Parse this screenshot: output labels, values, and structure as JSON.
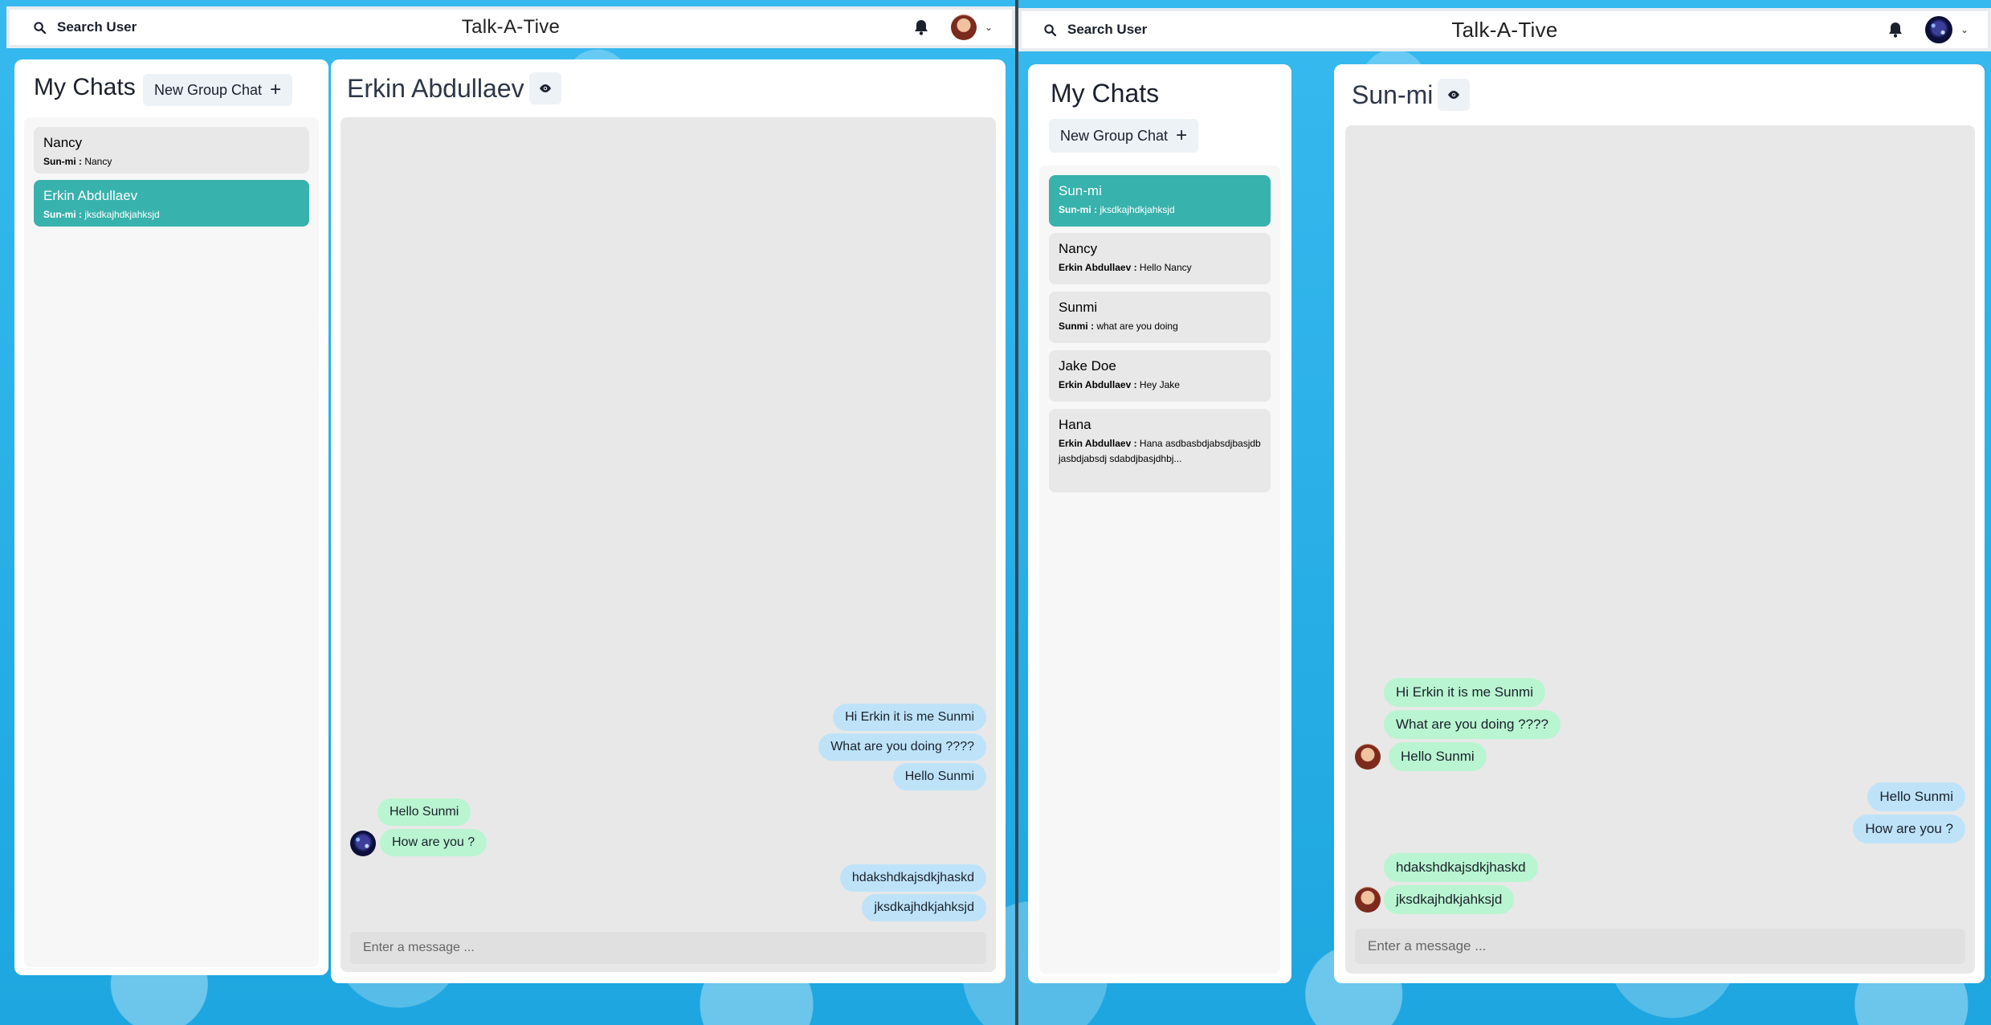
{
  "left": {
    "topbar": {
      "search_label": "Search User",
      "app_title": "Talk-A-Tive"
    },
    "sidebar": {
      "title": "My Chats",
      "new_group_label": "New Group Chat",
      "chats": [
        {
          "name": "Nancy",
          "sender": "Sun-mi :",
          "message": "Nancy",
          "active": false
        },
        {
          "name": "Erkin Abdullaev",
          "sender": "Sun-mi :",
          "message": "jksdkajhdkjahksjd",
          "active": true
        }
      ]
    },
    "chat": {
      "title": "Erkin Abdullaev",
      "messages": [
        {
          "text": "Hi Erkin it is me Sunmi",
          "type": "sent"
        },
        {
          "text": "What are you doing ????",
          "type": "sent"
        },
        {
          "text": "Hello Sunmi",
          "type": "sent"
        },
        {
          "text": "Hello Sunmi",
          "type": "received"
        },
        {
          "text": "How are you ?",
          "type": "received"
        },
        {
          "text": "hdakshdkajsdkjhaskd",
          "type": "sent"
        },
        {
          "text": "jksdkajhdkjahksjd",
          "type": "sent"
        }
      ],
      "input_placeholder": "Enter a message ..."
    }
  },
  "right": {
    "topbar": {
      "search_label": "Search User",
      "app_title": "Talk-A-Tive"
    },
    "sidebar": {
      "title": "My Chats",
      "new_group_label": "New Group Chat",
      "chats": [
        {
          "name": "Sun-mi",
          "sender": "Sun-mi :",
          "message": "jksdkajhdkjahksjd",
          "active": true
        },
        {
          "name": "Nancy",
          "sender": "Erkin Abdullaev :",
          "message": "Hello Nancy",
          "active": false
        },
        {
          "name": "Sunmi",
          "sender": "Sunmi :",
          "message": "what are you doing",
          "active": false
        },
        {
          "name": "Jake Doe",
          "sender": "Erkin Abdullaev :",
          "message": "Hey Jake",
          "active": false
        },
        {
          "name": "Hana",
          "sender": "Erkin Abdullaev :",
          "message": "Hana asdbasbdjabsdjbasjdbjasbdjabsdj sdabdjbasjdhbj...",
          "active": false
        }
      ]
    },
    "chat": {
      "title": "Sun-mi",
      "messages": [
        {
          "text": "Hi Erkin it is me Sunmi",
          "type": "received"
        },
        {
          "text": "What are you doing ????",
          "type": "received"
        },
        {
          "text": "Hello Sunmi",
          "type": "received"
        },
        {
          "text": "Hello Sunmi",
          "type": "sent"
        },
        {
          "text": "How are you ?",
          "type": "sent"
        },
        {
          "text": "hdakshdkajsdkjhaskd",
          "type": "received"
        },
        {
          "text": "jksdkajhdkjahksjd",
          "type": "received"
        }
      ],
      "input_placeholder": "Enter a message ..."
    }
  },
  "colors": {
    "accent": "#38b2ac",
    "sent_bubble": "#bee3f8",
    "received_bubble": "#b9f5d0"
  },
  "icons": [
    "search-icon",
    "bell-icon",
    "chevron-down-icon",
    "plus-icon",
    "eye-icon"
  ]
}
